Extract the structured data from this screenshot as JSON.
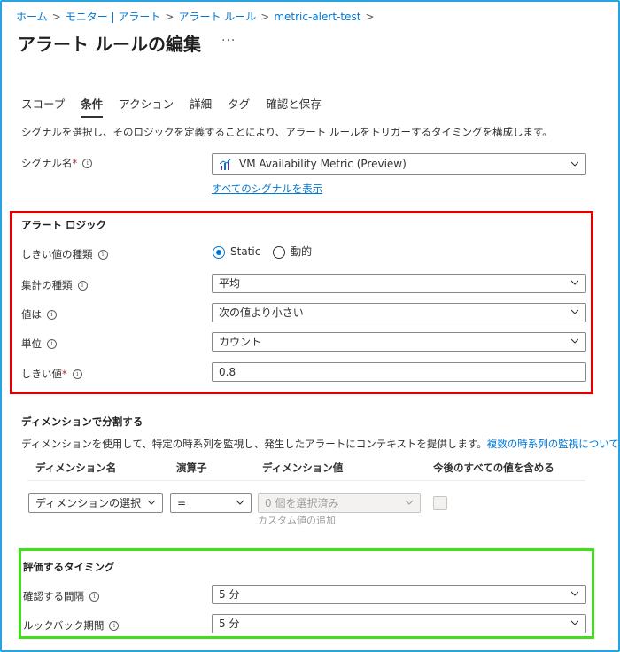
{
  "breadcrumb": [
    "ホーム",
    "モニター | アラート",
    "アラート ルール",
    "metric-alert-test"
  ],
  "page_title": "アラート ルールの編集",
  "more_label": "···",
  "tabs": [
    {
      "label": "スコープ",
      "active": false
    },
    {
      "label": "条件",
      "active": true
    },
    {
      "label": "アクション",
      "active": false
    },
    {
      "label": "詳細",
      "active": false
    },
    {
      "label": "タグ",
      "active": false
    },
    {
      "label": "確認と保存",
      "active": false
    }
  ],
  "description": "シグナルを選択し、そのロジックを定義することにより、アラート ルールをトリガーするタイミングを構成します。",
  "signal": {
    "label": "シグナル名",
    "required": "*",
    "value": "VM Availability Metric (Preview)",
    "show_all_link": "すべてのシグナルを表示",
    "icon": "metric-chart-icon"
  },
  "alert_logic": {
    "heading": "アラート ロジック",
    "threshold_type": {
      "label": "しきい値の種類",
      "options": [
        "Static",
        "動的"
      ],
      "selected": "Static"
    },
    "aggregation": {
      "label": "集計の種類",
      "value": "平均"
    },
    "operator": {
      "label": "値は",
      "value": "次の値より小さい"
    },
    "unit": {
      "label": "単位",
      "value": "カウント"
    },
    "threshold": {
      "label": "しきい値",
      "required": "*",
      "value": "0.8"
    }
  },
  "dimensions": {
    "heading": "ディメンションで分割する",
    "description": "ディメンションを使用して、特定の時系列を監視し、発生したアラートにコンテキストを提供します。",
    "link": "複数の時系列の監視について",
    "columns": [
      "ディメンション名",
      "演算子",
      "ディメンション値",
      "今後のすべての値を含める"
    ],
    "row": {
      "name_placeholder": "ディメンションの選択",
      "operator": "=",
      "values": "0 個を選択済み",
      "custom_add": "カスタム値の追加"
    }
  },
  "evaluation": {
    "heading": "評価するタイミング",
    "frequency": {
      "label": "確認する間隔",
      "value": "5 分"
    },
    "lookback": {
      "label": "ルックバック期間",
      "value": "5 分"
    }
  },
  "colors": {
    "accent": "#0078d4",
    "red_box": "#e00000",
    "green_box": "#3fe01a",
    "frame": "#29a3e0"
  }
}
